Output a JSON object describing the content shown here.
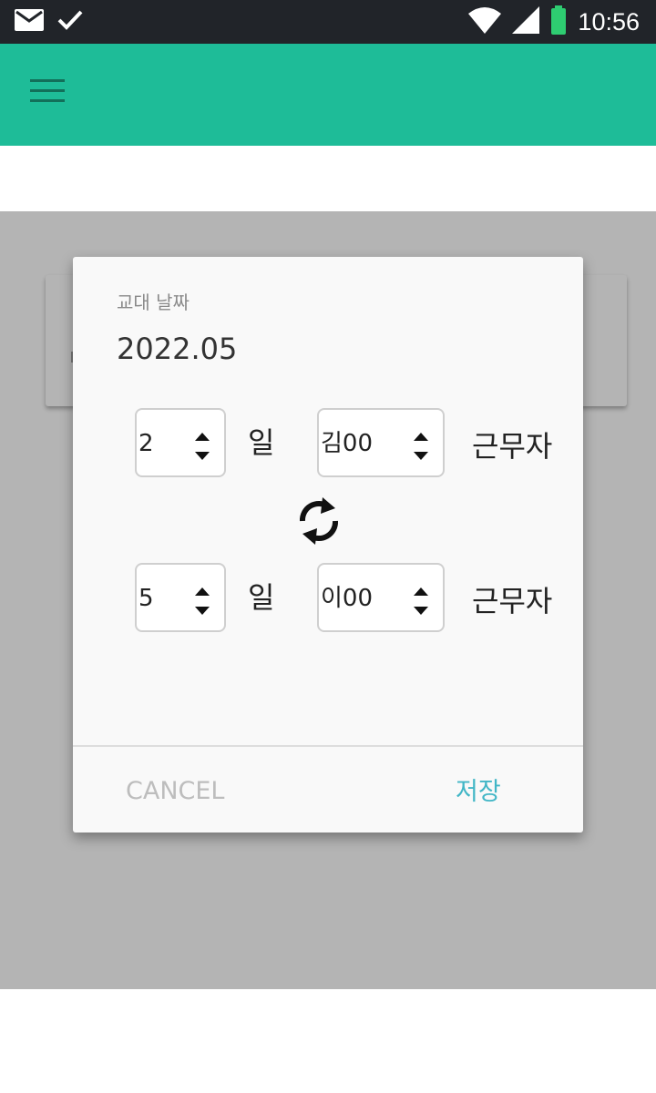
{
  "status_bar": {
    "time": "10:56",
    "icons": [
      "mail-icon",
      "check-icon",
      "wifi-icon",
      "signal-icon",
      "battery-icon"
    ]
  },
  "app_bar": {
    "color": "#1ebc98",
    "menu_icon": "menu-icon"
  },
  "dialog": {
    "caption": "교대 날짜",
    "date": "2022.05",
    "rows": [
      {
        "day": "2",
        "day_unit": "일",
        "worker": "김00",
        "worker_unit": "근무자"
      },
      {
        "day": "5",
        "day_unit": "일",
        "worker": "이00",
        "worker_unit": "근무자"
      }
    ],
    "swap_icon": "swap-icon",
    "cancel_label": "CANCEL",
    "save_label": "저장",
    "accent_color": "#41b6c6"
  }
}
